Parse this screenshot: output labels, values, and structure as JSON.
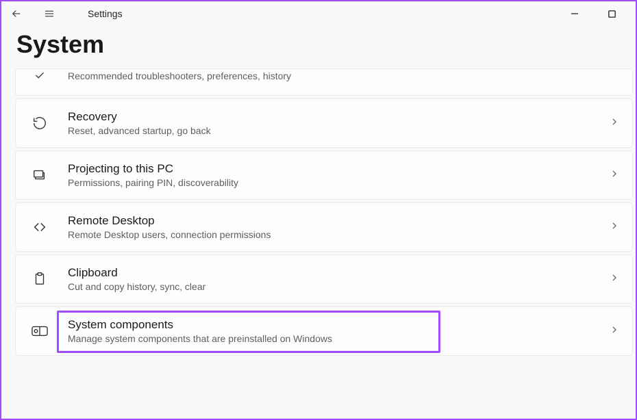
{
  "app_title": "Settings",
  "page_title": "System",
  "rows": {
    "troubleshoot": {
      "title": "",
      "sub": "Recommended troubleshooters, preferences, history"
    },
    "recovery": {
      "title": "Recovery",
      "sub": "Reset, advanced startup, go back"
    },
    "projecting": {
      "title": "Projecting to this PC",
      "sub": "Permissions, pairing PIN, discoverability"
    },
    "remote": {
      "title": "Remote Desktop",
      "sub": "Remote Desktop users, connection permissions"
    },
    "clipboard": {
      "title": "Clipboard",
      "sub": "Cut and copy history, sync, clear"
    },
    "syscomp": {
      "title": "System components",
      "sub": "Manage system components that are preinstalled on Windows"
    }
  }
}
